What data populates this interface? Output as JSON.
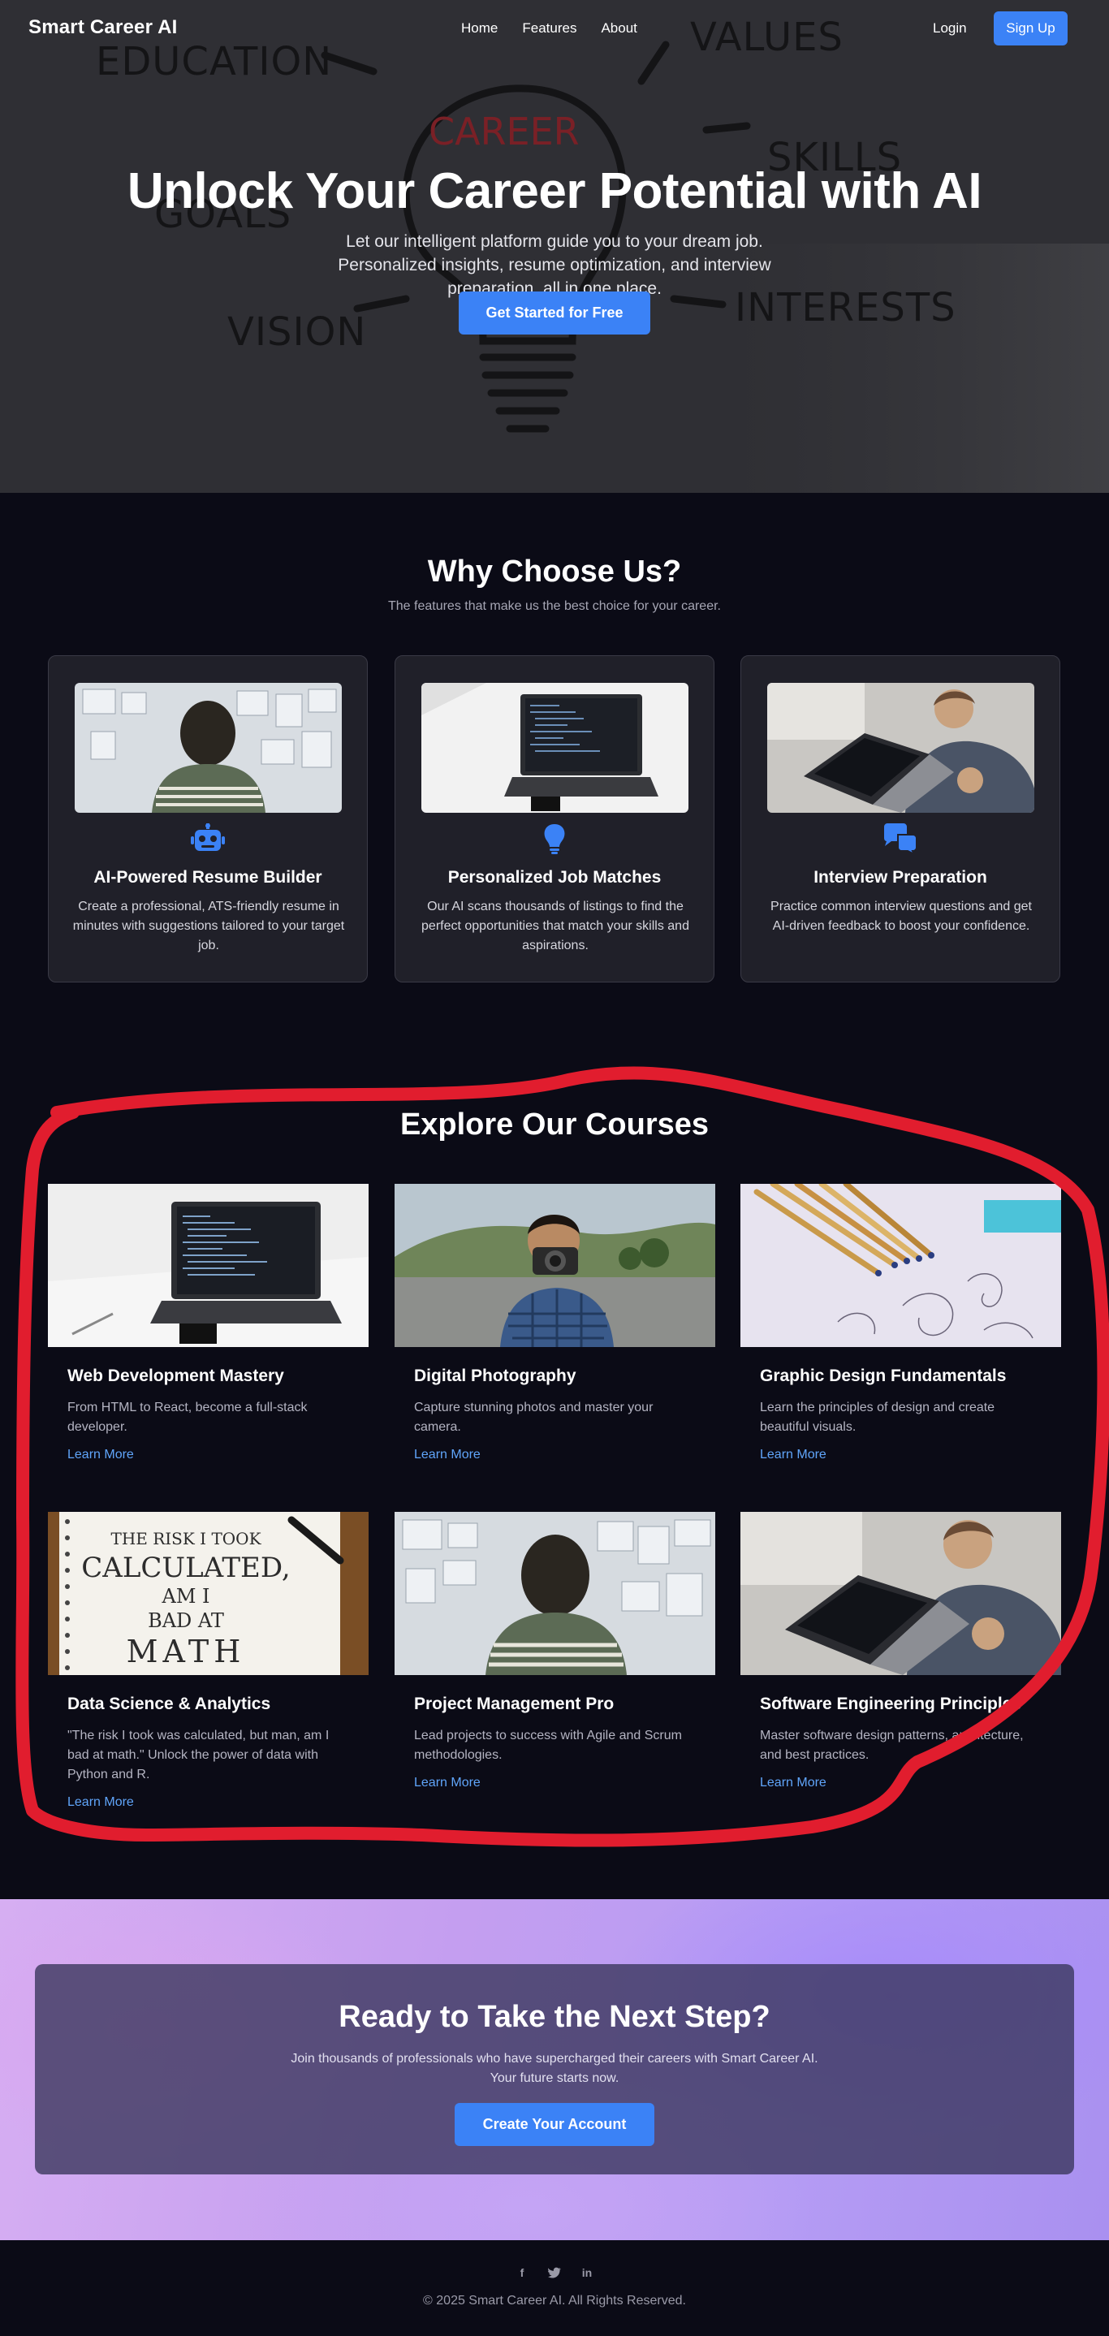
{
  "nav": {
    "brand": "Smart Career AI",
    "links": [
      "Home",
      "Features",
      "About"
    ],
    "login": "Login",
    "signup": "Sign Up"
  },
  "hero": {
    "title": "Unlock Your Career Potential with AI",
    "subtitle": "Let our intelligent platform guide you to your dream job. Personalized insights, resume optimization, and interview preparation, all in one place.",
    "cta": "Get Started for Free",
    "background_words": [
      "EDUCATION",
      "VALUES",
      "CAREER",
      "SKILLS",
      "GOALS",
      "VISION",
      "INTERESTS"
    ]
  },
  "why": {
    "title": "Why Choose Us?",
    "subtitle": "The features that make us the best choice for your career.",
    "features": [
      {
        "icon": "robot-icon",
        "title": "AI-Powered Resume Builder",
        "desc": "Create a professional, ATS-friendly resume in minutes with suggestions tailored to your target job."
      },
      {
        "icon": "lightbulb-icon",
        "title": "Personalized Job Matches",
        "desc": "Our AI scans thousands of listings to find the perfect opportunities that match your skills and aspirations."
      },
      {
        "icon": "chat-bubbles-icon",
        "title": "Interview Preparation",
        "desc": "Practice common interview questions and get AI-driven feedback to boost your confidence."
      }
    ]
  },
  "courses": {
    "title": "Explore Our Courses",
    "link_label": "Learn More",
    "items": [
      {
        "title": "Web Development Mastery",
        "desc": "From HTML to React, become a full-stack developer."
      },
      {
        "title": "Digital Photography",
        "desc": "Capture stunning photos and master your camera."
      },
      {
        "title": "Graphic Design Fundamentals",
        "desc": "Learn the principles of design and create beautiful visuals."
      },
      {
        "title": "Data Science & Analytics",
        "desc": "\"The risk I took was calculated, but man, am I bad at math.\" Unlock the power of data with Python and R."
      },
      {
        "title": "Project Management Pro",
        "desc": "Lead projects to success with Agile and Scrum methodologies."
      },
      {
        "title": "Software Engineering Principles",
        "desc": "Master software design patterns, architecture, and best practices."
      }
    ],
    "math_art": {
      "line1": "THE RISK I TOOK",
      "line2": "CALCULATED,",
      "line3": "AM I",
      "line4": "BAD AT",
      "line5": "MATH"
    }
  },
  "cta": {
    "title": "Ready to Take the Next Step?",
    "subtitle": "Join thousands of professionals who have supercharged their careers with Smart Career AI. Your future starts now.",
    "button": "Create Your Account"
  },
  "footer": {
    "socials": [
      "facebook-icon",
      "twitter-icon",
      "linkedin-icon"
    ],
    "facebook_glyph": "f",
    "linkedin_glyph": "in",
    "copyright": "© 2025 Smart Career AI. All Rights Reserved."
  },
  "colors": {
    "accent": "#3b82f6",
    "link": "#60a5fa",
    "annotation": "#e11d2e",
    "page_bg": "#0b0b16",
    "card_bg": "#202029"
  }
}
